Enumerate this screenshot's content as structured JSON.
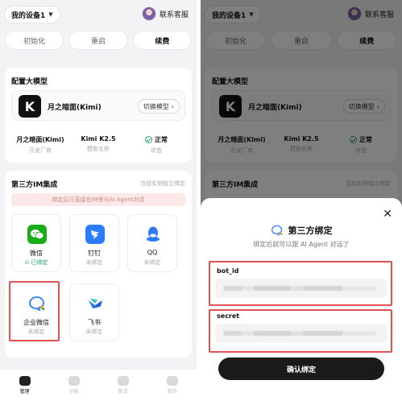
{
  "header": {
    "device_label": "我的设备1",
    "support_label": "联系客服"
  },
  "actions": {
    "init": "初始化",
    "restart": "重启",
    "renew": "续费"
  },
  "model": {
    "section_title": "配置大模型",
    "logo_letter": "K",
    "name": "月之暗面(Kimi)",
    "switch_label": "切换模型",
    "stats": [
      {
        "value": "月之暗面(Kimi)",
        "label": "开发厂商"
      },
      {
        "value": "Kimi K2.5",
        "label": "模型名称"
      },
      {
        "value": "正常",
        "label": "状态"
      }
    ]
  },
  "im": {
    "section_title": "第三方IM集成",
    "section_sub": "当前实例独立绑定",
    "tip": "绑定后可直接在IM里与AI Agent对话",
    "tiles": [
      {
        "name": "微信",
        "status": "已绑定"
      },
      {
        "name": "钉钉",
        "status": "未绑定"
      },
      {
        "name": "QQ",
        "status": "未绑定"
      },
      {
        "name": "企业微信",
        "status": "未绑定"
      },
      {
        "name": "飞书",
        "status": "未绑定"
      }
    ]
  },
  "nav": {
    "items": [
      "管理",
      "功能",
      "复活",
      "我的"
    ]
  },
  "sheet": {
    "close": "✕",
    "title": "第三方绑定",
    "subtitle": "绑定后就可以跟 AI Agent 对话了",
    "bot_id_label": "bot_id",
    "secret_label": "secret",
    "confirm": "确认绑定"
  },
  "colors": {
    "highlight": "#e0524f",
    "bound": "#2aa36b",
    "primary_dark": "#1a1a1a"
  }
}
